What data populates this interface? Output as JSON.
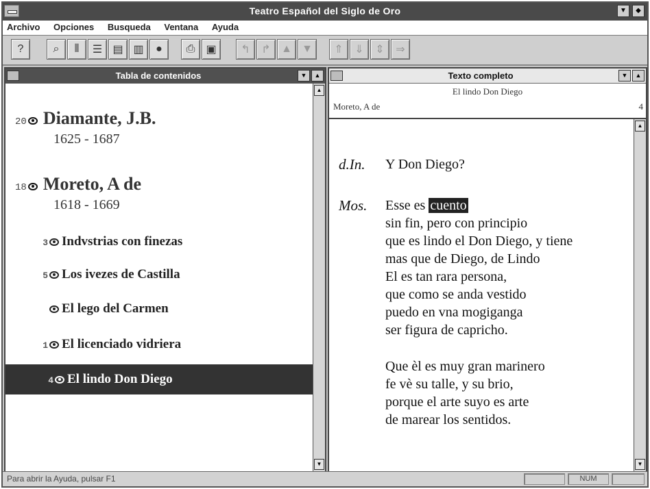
{
  "window": {
    "title": "Teatro Español del Siglo de Oro"
  },
  "menu": [
    "Archivo",
    "Opciones",
    "Busqueda",
    "Ventana",
    "Ayuda"
  ],
  "toolbar_icons": [
    "help-icon",
    "search-icon",
    "column-icon",
    "list-icon",
    "table-icon",
    "book-icon",
    "stop-icon",
    "print-icon",
    "save-icon",
    "back-icon",
    "forward-icon",
    "up-icon",
    "down-icon",
    "page-up-icon",
    "page-down-icon",
    "jump-icon",
    "next-icon"
  ],
  "left_pane": {
    "title": "Tabla de contenidos",
    "authors": [
      {
        "count": "20",
        "name": "Diamante, J.B.",
        "years": "1625 - 1687"
      },
      {
        "count": "18",
        "name": "Moreto, A de",
        "years": "1618 - 1669"
      }
    ],
    "works": [
      {
        "count": "3",
        "title": "Indvstrias con finezas"
      },
      {
        "count": "5",
        "title": "Los ivezes de Castilla"
      },
      {
        "count": "",
        "title": "El lego del Carmen"
      },
      {
        "count": "1",
        "title": "El licenciado vidriera"
      },
      {
        "count": "4",
        "title": "El lindo Don Diego"
      }
    ]
  },
  "right_pane": {
    "title": "Texto completo",
    "work_title": "El lindo Don Diego",
    "author": "Moreto, A de",
    "page": "4",
    "speech1": {
      "speaker": "d.In.",
      "line": "Y Don Diego?"
    },
    "speech2": {
      "speaker": "Mos.",
      "first_pre": "Esse es ",
      "highlight": "cuento",
      "lines": [
        "sin fin, pero con principio",
        "que es lindo el Don Diego, y tiene",
        "mas que de Diego, de Lindo",
        "El es tan rara persona,",
        "que como se anda vestido",
        "puedo en vna mogiganga",
        "ser figura de capricho."
      ],
      "stanza2": [
        "Que èl es muy gran marinero",
        "fe vè su talle, y su brio,",
        "porque el arte suyo es arte",
        "de marear los sentidos."
      ]
    }
  },
  "status": {
    "message": "Para abrir la Ayuda, pulsar F1",
    "num": "NUM"
  }
}
